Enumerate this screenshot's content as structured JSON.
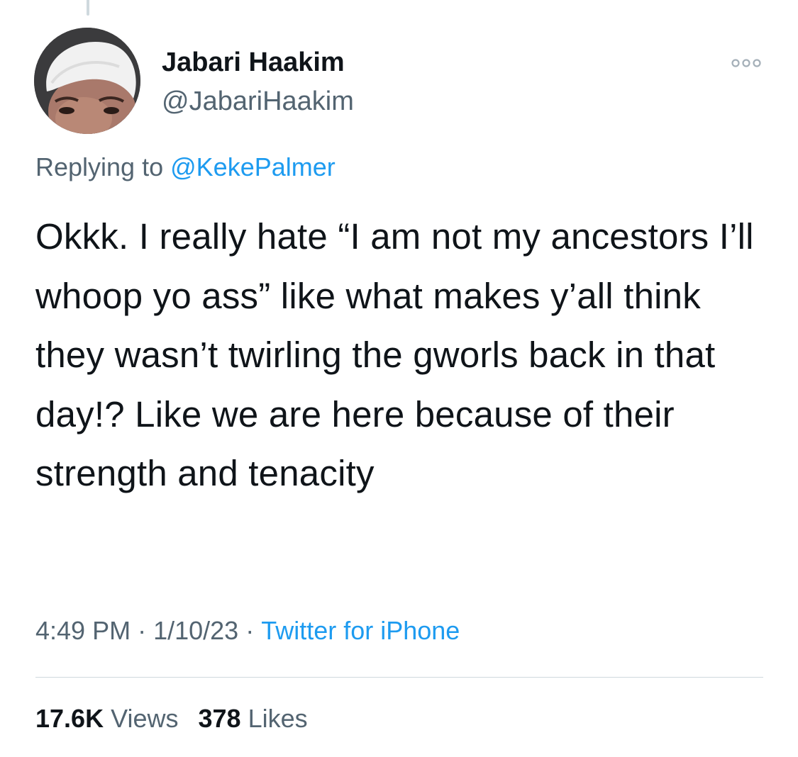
{
  "tweet": {
    "author_name": "Jabari Haakim",
    "author_handle": "@JabariHaakim",
    "replying_prefix": "Replying to ",
    "replying_to": "@KekePalmer",
    "text": "Okkk. I really hate “I am not my ancestors I’ll whoop yo ass” like what makes y’all think they wasn’t twirling the gworls back in that day!? Like we are here because of their strength and tenacity",
    "time": "4:49 PM",
    "separator": "·",
    "date": "1/10/23",
    "source": "Twitter for iPhone",
    "views_count": "17.6K",
    "views_label": "Views",
    "likes_count": "378",
    "likes_label": "Likes"
  },
  "icons": {
    "more": "more-horizontal-icon",
    "avatar": "profile-photo"
  },
  "colors": {
    "text_primary": "#0f1419",
    "text_secondary": "#536471",
    "link": "#1d9bf0",
    "divider": "#cfd9de"
  }
}
